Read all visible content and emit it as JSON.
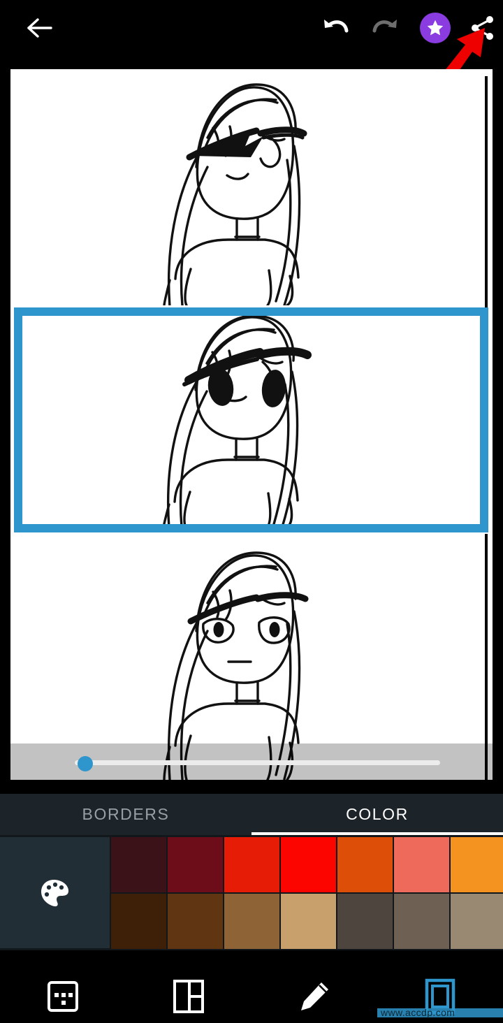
{
  "app": {
    "background_color": "#000000",
    "accent_color": "#2e96cc",
    "panel_color": "#1c2329"
  },
  "topbar": {
    "back_label": "back-arrow",
    "undo_label": "Undo",
    "redo_label": "Redo",
    "star_label": "Premium",
    "share_label": "Share",
    "star_circle_color": "#8a3ce0",
    "undo_state": "enabled",
    "redo_state": "disabled"
  },
  "annotation": {
    "arrow_color": "#ee0000",
    "points_to": "share-button"
  },
  "canvas": {
    "background": "#ffffff",
    "frames": [
      {
        "index": 1,
        "selected": false,
        "description": "sketch of girl with long hair, inked eyebrows, blank eyes"
      },
      {
        "index": 2,
        "selected": true,
        "description": "sketch of girl with long hair, fully inked black eyes"
      },
      {
        "index": 3,
        "selected": false,
        "description": "sketch of girl with long hair, outlined eyes with pupils"
      }
    ],
    "selection_border_color": "#2e96cc"
  },
  "slider": {
    "name": "border-width-slider",
    "value_percent": 2,
    "thumb_color": "#2e96cc",
    "track_color": "#ececec"
  },
  "tabs": [
    {
      "id": "borders",
      "label": "BORDERS",
      "active": false
    },
    {
      "id": "color",
      "label": "COLOR",
      "active": true
    }
  ],
  "palette": {
    "button_label": "palette-picker",
    "button_bg": "#222e36",
    "rows": [
      [
        "#3b1218",
        "#6d0d1a",
        "#e61c07",
        "#fc0400",
        "#dd4e08",
        "#ee6a5b",
        "#f4931f",
        "#f4a06a"
      ],
      [
        "#3e2008",
        "#603512",
        "#8e6335",
        "#c8a06c",
        "#4e453f",
        "#6e6154",
        "#9a8972",
        "#c8a06c"
      ]
    ]
  },
  "bottom_nav": [
    {
      "id": "stickers",
      "icon": "sticker-square-icon",
      "active": false
    },
    {
      "id": "layout",
      "icon": "collage-layout-icon",
      "active": false
    },
    {
      "id": "draw",
      "icon": "pencil-icon",
      "active": false
    },
    {
      "id": "border",
      "icon": "frame-border-icon",
      "active": true
    }
  ],
  "watermark": {
    "text": "www.accdp.com"
  }
}
